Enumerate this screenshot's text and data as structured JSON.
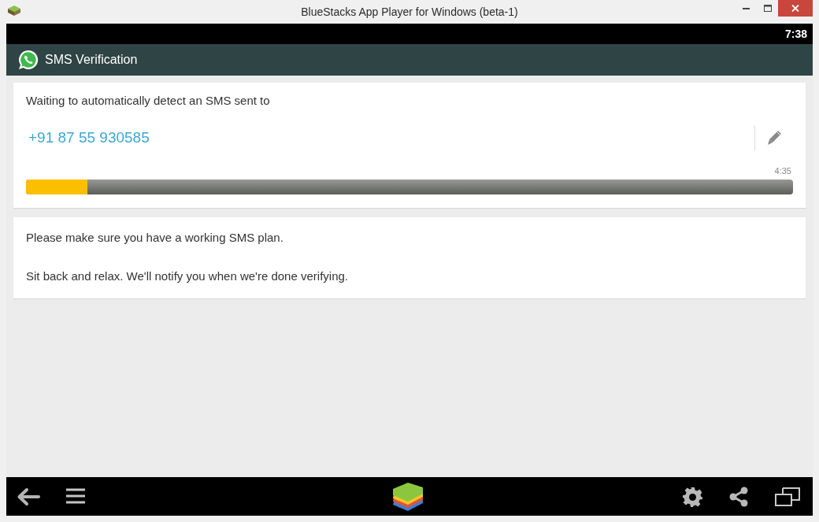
{
  "window": {
    "title": "BlueStacks App Player for Windows (beta-1)"
  },
  "status_bar": {
    "time": "7:38"
  },
  "app_bar": {
    "title": "SMS Verification"
  },
  "verification_card": {
    "message": "Waiting to automatically detect an SMS sent to",
    "phone_number": "+91 87 55 930585",
    "timer": "4:35",
    "progress": {
      "level": 0.08
    }
  },
  "info_card": {
    "paragraphs": [
      "Please make sure you have a working SMS plan.",
      "Sit back and relax. We'll notify you when we're done verifying."
    ]
  }
}
